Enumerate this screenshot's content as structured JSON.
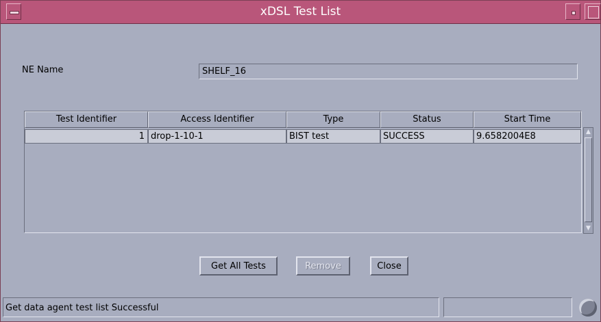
{
  "window": {
    "title": "xDSL Test List"
  },
  "form": {
    "ne_name_label": "NE Name",
    "ne_name_value": "SHELF_16"
  },
  "table": {
    "columns": [
      "Test Identifier",
      "Access Identifier",
      "Type",
      "Status",
      "Start Time"
    ],
    "rows": [
      {
        "test_identifier": "1",
        "access_identifier": "drop-1-10-1",
        "type": "BIST test",
        "status": "SUCCESS",
        "start_time": "9.6582004E8"
      }
    ]
  },
  "buttons": {
    "get_all_tests": "Get All Tests",
    "remove": "Remove",
    "close": "Close"
  },
  "status": {
    "message": "Get data agent test list Successful",
    "secondary": ""
  },
  "icons": {
    "window_menu": "window-menu-icon",
    "minimize": "minimize-icon",
    "maximize": "maximize-icon",
    "scroll_up": "scroll-up-arrow-icon",
    "scroll_down": "scroll-down-arrow-icon",
    "status": "status-indicator-icon"
  },
  "colors": {
    "titlebar": "#b9567a",
    "background": "#a8adbf",
    "selected_row": "#c9ccd7"
  }
}
